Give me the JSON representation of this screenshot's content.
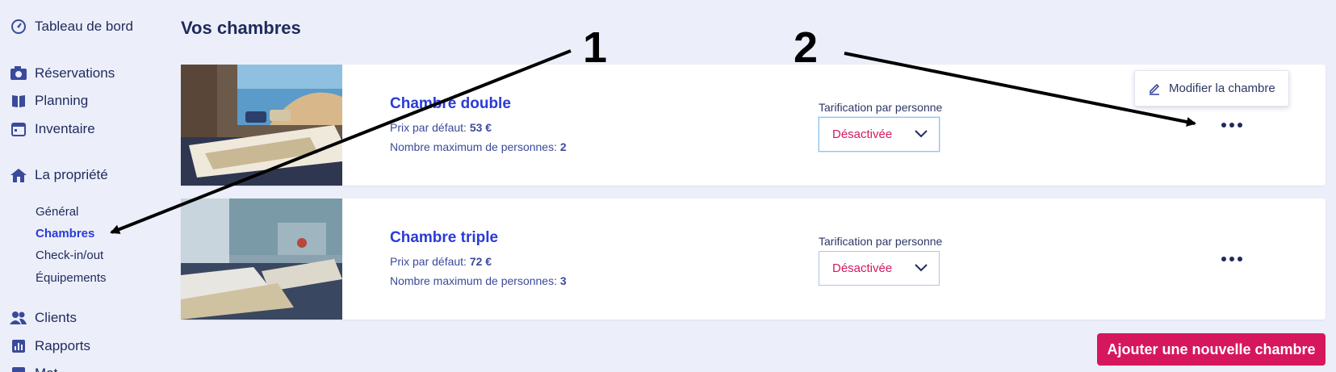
{
  "sidebar": {
    "dashboard": "Tableau de bord",
    "reservations": "Réservations",
    "planning": "Planning",
    "inventory": "Inventaire",
    "property": "La propriété",
    "property_items": [
      "Général",
      "Chambres",
      "Check-in/out",
      "Équipements"
    ],
    "clients": "Clients",
    "reports": "Rapports",
    "truncated_item": "Mot…"
  },
  "page": {
    "title": "Vos chambres"
  },
  "rooms": [
    {
      "name": "Chambre double",
      "price_label": "Prix par défaut:",
      "price": "53 €",
      "max_label": "Nombre maximum de personnes:",
      "max": "2",
      "pricing_label": "Tarification par personne",
      "pricing_value": "Désactivée"
    },
    {
      "name": "Chambre triple",
      "price_label": "Prix par défaut:",
      "price": "72 €",
      "max_label": "Nombre maximum de personnes:",
      "max": "3",
      "pricing_label": "Tarification par personne",
      "pricing_value": "Désactivée"
    }
  ],
  "context_menu": {
    "edit_label": "Modifier la chambre"
  },
  "actions": {
    "add_room": "Ajouter une nouvelle chambre"
  },
  "annotations": {
    "one": "1",
    "two": "2"
  },
  "colors": {
    "accent": "#2a3bd6",
    "brand": "#d6175e",
    "text": "#1f2a5c",
    "background": "#eceff9"
  }
}
